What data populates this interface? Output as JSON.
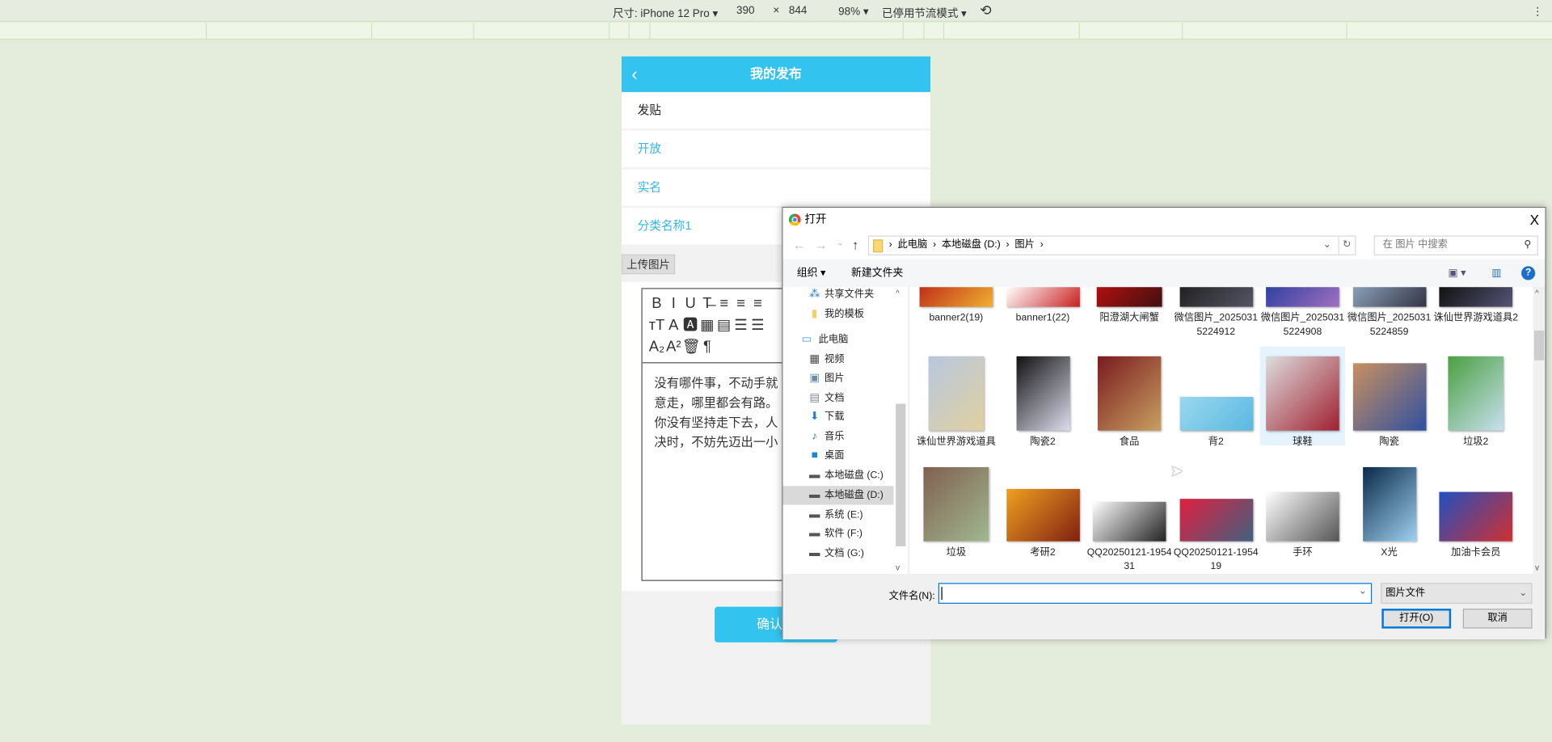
{
  "devtools": {
    "device_label": "尺寸: iPhone 12 Pro ▾",
    "width": "390",
    "times": "×",
    "height": "844",
    "zoom": "98% ▾",
    "throttle": "已停用节流模式 ▾",
    "rotate_icon": "rotate-icon",
    "more": "⋮"
  },
  "phone": {
    "title": "我的发布",
    "back": "‹",
    "rows": [
      "发贴",
      "开放",
      "实名",
      "分类名称1"
    ],
    "upload_label": "上传图片",
    "toolbar_rows": [
      [
        "B",
        "I",
        "U",
        "T̶",
        "≡",
        "≡",
        "≡"
      ],
      [
        "ᴛT",
        "A",
        "🅰",
        "▦",
        "▤",
        "☰",
        "☰"
      ],
      [
        "A₂",
        "A²",
        "🗑",
        "¶"
      ]
    ],
    "editor_text": "没有哪件事，不动手就\n意走，哪里都会有路。\n你没有坚持走下去，人\n决时，不妨先迈出一小",
    "confirm": "确认提"
  },
  "dialog": {
    "title": "打开",
    "close": "X",
    "nav": {
      "back": "←",
      "forward": "→",
      "recent": "⌄",
      "up": "↑"
    },
    "breadcrumb": [
      "此电脑",
      "本地磁盘 (D:)",
      "图片"
    ],
    "search_placeholder": "在 图片 中搜索",
    "organize": "组织 ▾",
    "new_folder": "新建文件夹",
    "sidebar": [
      {
        "label": "共享文件夹",
        "icon": "share-icon",
        "glyph": "⁂",
        "color": "#2b7bd6"
      },
      {
        "label": "我的模板",
        "icon": "folder-icon",
        "glyph": "▮",
        "color": "#f4cf62"
      },
      {
        "label": "此电脑",
        "icon": "computer-icon",
        "glyph": "▭",
        "color": "#3a9be0",
        "top": true
      },
      {
        "label": "视频",
        "icon": "video-icon",
        "glyph": "▦",
        "color": "#444"
      },
      {
        "label": "图片",
        "icon": "pictures-icon",
        "glyph": "▣",
        "color": "#6a8aa8"
      },
      {
        "label": "文档",
        "icon": "documents-icon",
        "glyph": "▤",
        "color": "#7a8a9a"
      },
      {
        "label": "下载",
        "icon": "download-icon",
        "glyph": "⬇",
        "color": "#2b7bd6"
      },
      {
        "label": "音乐",
        "icon": "music-icon",
        "glyph": "♪",
        "color": "#2b7bd6"
      },
      {
        "label": "桌面",
        "icon": "desktop-icon",
        "glyph": "■",
        "color": "#1a88d8"
      },
      {
        "label": "本地磁盘 (C:)",
        "icon": "drive-icon",
        "glyph": "▬",
        "color": "#555"
      },
      {
        "label": "本地磁盘 (D:)",
        "icon": "drive-icon",
        "glyph": "▬",
        "color": "#555",
        "selected": true
      },
      {
        "label": "系统 (E:)",
        "icon": "drive-icon",
        "glyph": "▬",
        "color": "#555"
      },
      {
        "label": "软件 (F:)",
        "icon": "drive-icon",
        "glyph": "▬",
        "color": "#555"
      },
      {
        "label": "文档 (G:)",
        "icon": "drive-icon",
        "glyph": "▬",
        "color": "#555"
      }
    ],
    "files": [
      {
        "name": "banner2(19)",
        "colors": [
          "#c0301a",
          "#f0b030"
        ]
      },
      {
        "name": "banner1(22)",
        "colors": [
          "#fff",
          "#c82020"
        ]
      },
      {
        "name": "阳澄湖大闸蟹",
        "colors": [
          "#b01010",
          "#401010"
        ]
      },
      {
        "name": "微信图片_20250315224912",
        "colors": [
          "#222",
          "#556"
        ]
      },
      {
        "name": "微信图片_20250315224908",
        "colors": [
          "#3040a0",
          "#a070c0"
        ]
      },
      {
        "name": "微信图片_20250315224859",
        "colors": [
          "#8aa0b8",
          "#334"
        ]
      },
      {
        "name": "诛仙世界游戏道具2",
        "colors": [
          "#111",
          "#557"
        ]
      },
      {
        "name": "诛仙世界游戏道具",
        "colors": [
          "#b8c8e0",
          "#e0d0a0"
        ]
      },
      {
        "name": "陶瓷2",
        "colors": [
          "#111",
          "#dde"
        ]
      },
      {
        "name": "食品",
        "colors": [
          "#7a1a20",
          "#c8a060"
        ]
      },
      {
        "name": "背2",
        "colors": [
          "#9ad8f0",
          "#5ab8e0"
        ]
      },
      {
        "name": "球鞋",
        "colors": [
          "#ddd",
          "#a02030"
        ],
        "selected": true
      },
      {
        "name": "陶瓷",
        "colors": [
          "#c89060",
          "#3050a0"
        ]
      },
      {
        "name": "垃圾2",
        "colors": [
          "#4aa040",
          "#c8e0f0"
        ]
      },
      {
        "name": "垃圾",
        "colors": [
          "#806050",
          "#a0b890"
        ]
      },
      {
        "name": "考研2",
        "colors": [
          "#f0a020",
          "#802010"
        ]
      },
      {
        "name": "QQ20250121-195431",
        "colors": [
          "#fff",
          "#222"
        ]
      },
      {
        "name": "QQ20250121-195419",
        "colors": [
          "#e02040",
          "#406080"
        ]
      },
      {
        "name": "手环",
        "colors": [
          "#fff",
          "#555"
        ]
      },
      {
        "name": "X光",
        "colors": [
          "#0a2a4a",
          "#a0d0f0"
        ]
      },
      {
        "name": "加油卡会员",
        "colors": [
          "#2050c0",
          "#d03030"
        ]
      }
    ],
    "filename_label": "文件名(N):",
    "filename_value": "",
    "filetype": "图片文件",
    "open": "打开(O)",
    "cancel": "取消"
  }
}
